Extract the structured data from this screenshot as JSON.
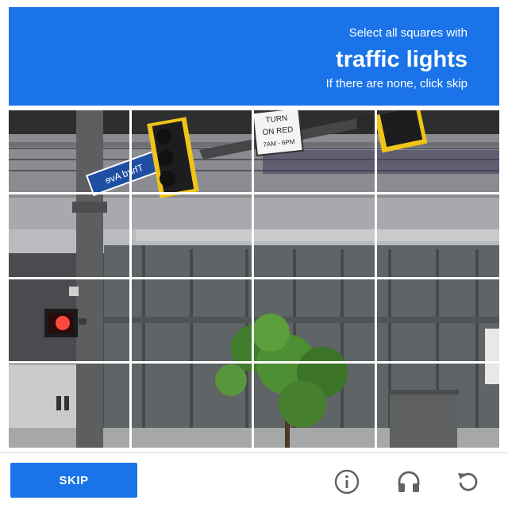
{
  "header": {
    "line1": "Select all squares with",
    "line2": "traffic lights",
    "line3": "If there are none, click skip"
  },
  "grid": {
    "rows": 4,
    "cols": 4,
    "street_sign_text": "Third Ave",
    "regulatory_sign_text": [
      "TURN",
      "ON RED",
      "7AM - 6PM"
    ]
  },
  "footer": {
    "skip_label": "SKIP",
    "icons": [
      "info-icon",
      "headphones-icon",
      "reload-icon"
    ]
  },
  "colors": {
    "accent": "#1a73e8",
    "tile_border": "#ffffff",
    "icon": "#5f6368"
  }
}
